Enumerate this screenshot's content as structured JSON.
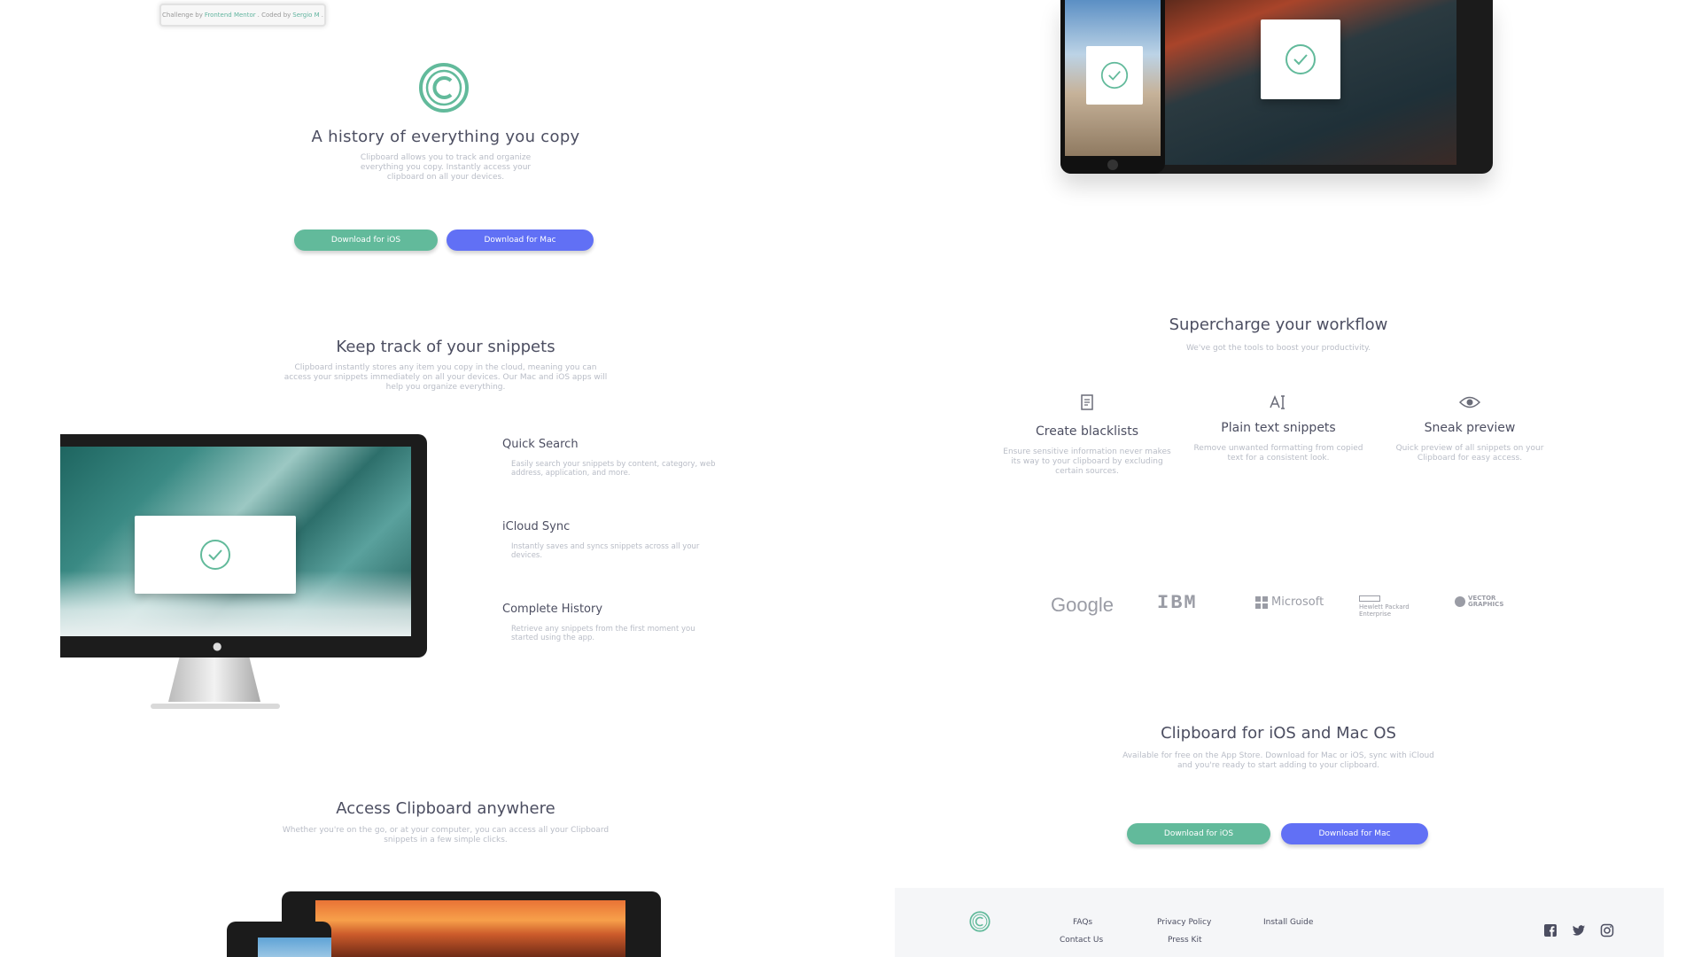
{
  "attribution": {
    "prefix": "Challenge by",
    "fm": "Frontend Mentor",
    "mid": ". Coded by",
    "author": "Sergio M",
    "suffix": "."
  },
  "hero": {
    "title": "A history of everything you copy",
    "description": "Clipboard allows you to track and organize everything you copy. Instantly access your clipboard on all your devices.",
    "btn_ios": "Download for iOS",
    "btn_mac": "Download for Mac"
  },
  "snippets": {
    "title": "Keep track of your snippets",
    "description": "Clipboard instantly stores any item you copy in the cloud, meaning you can access your snippets immediately on all your devices. Our Mac and iOS apps will help you organize everything.",
    "features": [
      {
        "title": "Quick Search",
        "desc": "Easily search your snippets by content, category, web address, application, and more."
      },
      {
        "title": "iCloud Sync",
        "desc": "Instantly saves and syncs snippets across all your devices."
      },
      {
        "title": "Complete History",
        "desc": "Retrieve any snippets from the first moment you started using the app."
      }
    ]
  },
  "access": {
    "title": "Access Clipboard anywhere",
    "description": "Whether you're on the go, or at your computer, you can access all your Clipboard snippets in a few simple clicks."
  },
  "workflow": {
    "title": "Supercharge your workflow",
    "subtitle": "We've got the tools to boost your productivity.",
    "items": [
      {
        "icon": "blacklist-icon",
        "title": "Create blacklists",
        "desc": "Ensure sensitive information never makes its way to your clipboard by excluding certain sources."
      },
      {
        "icon": "text-icon",
        "title": "Plain text snippets",
        "desc": "Remove unwanted formatting from copied text for a consistent look."
      },
      {
        "icon": "eye-icon",
        "title": "Sneak preview",
        "desc": "Quick preview of all snippets on your Clipboard for easy access."
      }
    ]
  },
  "partners": {
    "google": "Google",
    "ibm": "IBM",
    "microsoft": "Microsoft",
    "hp_line1": "Hewlett Packard",
    "hp_line2": "Enterprise",
    "vg_line1": "VECTOR",
    "vg_line2": "GRAPHICS"
  },
  "cta": {
    "title": "Clipboard for iOS and Mac OS",
    "description": "Available for free on the App Store. Download for Mac or iOS, sync with iCloud and you're ready to start adding to your clipboard.",
    "btn_ios": "Download for iOS",
    "btn_mac": "Download for Mac"
  },
  "footer": {
    "links": [
      "FAQs",
      "Contact Us",
      "Privacy Policy",
      "Press Kit",
      "Install Guide"
    ],
    "social": [
      "facebook-icon",
      "twitter-icon",
      "instagram-icon"
    ]
  },
  "colors": {
    "accent_green": "#62ba9b",
    "accent_blue": "#6170f5",
    "heading": "#4c4e61",
    "muted": "#b8bcc6"
  }
}
